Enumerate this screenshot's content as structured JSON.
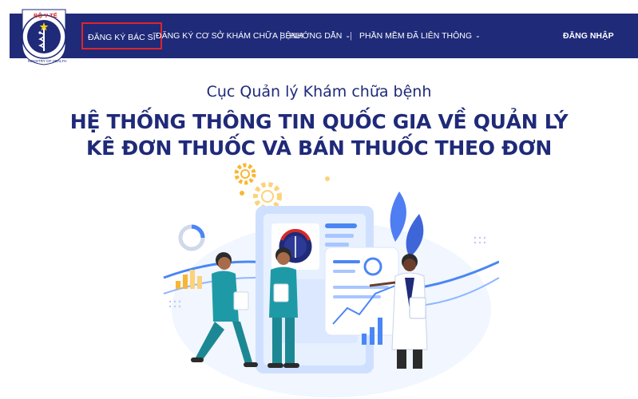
{
  "header": {
    "logo": {
      "top_text": "BỘ Y TẾ",
      "ring_text": "MINISTRY OF HEALTH",
      "icon": "caduceus-icon"
    },
    "nav": [
      {
        "label": "ĐĂNG KÝ BÁC SĨ",
        "active": true
      },
      {
        "label": "ĐĂNG KÝ CƠ SỞ KHÁM CHỮA BỆNH"
      },
      {
        "label": "HƯỚNG DẪN",
        "dropdown": true
      },
      {
        "label": "PHẦN MỀM ĐÃ LIÊN THÔNG",
        "dropdown": true
      }
    ],
    "separator": "|",
    "login_label": "ĐĂNG NHẬP",
    "colors": {
      "navbar": "#1f2a79",
      "active_border": "#e0242b"
    }
  },
  "hero": {
    "subtitle": "Cục Quản lý Khám chữa bệnh",
    "title_line1": "HỆ THỐNG THÔNG TIN QUỐC GIA VỀ QUẢN LÝ",
    "title_line2": "KÊ ĐƠN THUỐC VÀ BÁN THUỐC THEO ĐƠN",
    "illustration": "doctors-with-prescription-dashboard-illustration"
  }
}
